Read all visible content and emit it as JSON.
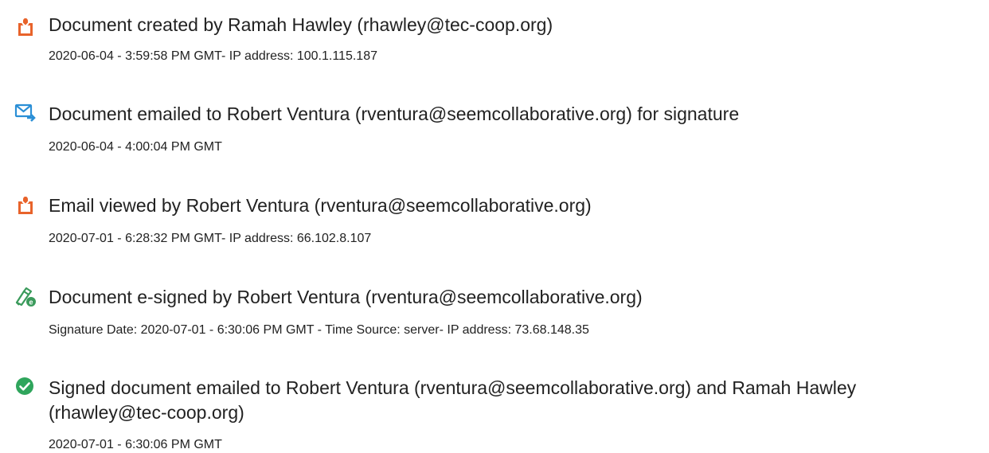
{
  "audit_trail": {
    "events": [
      {
        "icon": "document-created-icon",
        "title": "Document created by Ramah Hawley (rhawley@tec-coop.org)",
        "detail": "2020-06-04 - 3:59:58 PM GMT- IP address: 100.1.115.187"
      },
      {
        "icon": "email-sent-icon",
        "title": "Document emailed to Robert Ventura (rventura@seemcollaborative.org) for signature",
        "detail": "2020-06-04 - 4:00:04 PM GMT"
      },
      {
        "icon": "document-viewed-icon",
        "title": "Email viewed by Robert Ventura (rventura@seemcollaborative.org)",
        "detail": "2020-07-01 - 6:28:32 PM GMT- IP address: 66.102.8.107"
      },
      {
        "icon": "e-signature-icon",
        "title": "Document e-signed by Robert Ventura (rventura@seemcollaborative.org)",
        "detail": "Signature Date: 2020-07-01 - 6:30:06 PM GMT - Time Source: server- IP address: 73.68.148.35"
      },
      {
        "icon": "completed-check-icon",
        "title": "Signed document emailed to Robert Ventura (rventura@seemcollaborative.org) and Ramah Hawley (rhawley@tec-coop.org)",
        "detail": "2020-07-01 - 6:30:06 PM GMT"
      }
    ]
  },
  "colors": {
    "document_icon": "#e8632b",
    "email_icon": "#2b8fd6",
    "esign_icon": "#3a9a5b",
    "check_icon": "#2fa55c",
    "text": "#222222"
  }
}
